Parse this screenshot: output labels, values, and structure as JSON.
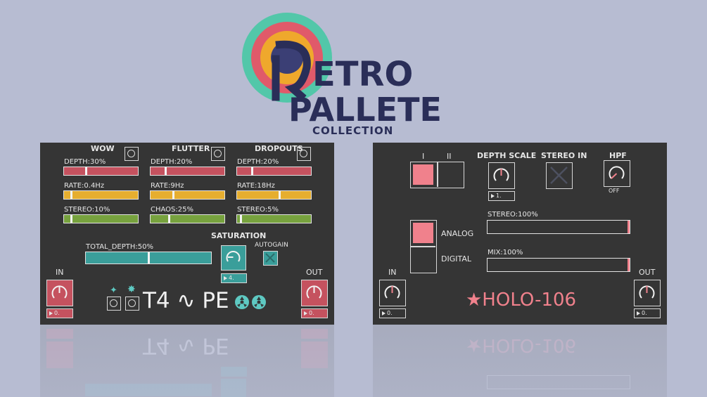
{
  "logo": {
    "retro": "ETRO",
    "pallete": "PALLETE",
    "collection": "COLLECTION",
    "colors": [
      "#52c7a9",
      "#e05a6a",
      "#efa82c",
      "#3b3f75"
    ]
  },
  "tape": {
    "sections": {
      "wow": "WOW",
      "flutter": "FLUTTER",
      "dropouts": "DROPOUTS"
    },
    "wow": {
      "depth": "DEPTH:30%",
      "rate": "RATE:0.4Hz",
      "stereo": "STEREO:10%"
    },
    "flutter": {
      "depth": "DEPTH:20%",
      "rate": "RATE:9Hz",
      "chaos": "CHAOS:25%"
    },
    "dropouts": {
      "depth": "DEPTH:20%",
      "rate": "RATE:18Hz",
      "stereo": "STEREO:5%"
    },
    "levels": {
      "wow_depth": 0.3,
      "wow_rate": 0.1,
      "wow_stereo": 0.1,
      "flutter_depth": 0.2,
      "flutter_rate": 0.31,
      "flutter_chaos": 0.25,
      "dropouts_depth": 0.2,
      "dropouts_rate": 0.58,
      "dropouts_stereo": 0.05,
      "total_depth": 0.5
    },
    "saturation": "SATURATION",
    "autogain": "AUTOGAIN",
    "total_depth": "TOTAL_DEPTH:50%",
    "saturation_value": "4.",
    "in_label": "IN",
    "out_label": "OUT",
    "in_value": "0.",
    "out_value": "0.",
    "name": "T4 ∿ PE",
    "colors": {
      "red": "#c5525f",
      "yellow": "#e6ae2f",
      "green": "#77a23e",
      "teal": "#3a9e9a"
    }
  },
  "holo": {
    "mode_i": "I",
    "mode_ii": "II",
    "depth_scale": "DEPTH SCALE",
    "depth_scale_value": "1.",
    "stereo_in": "STEREO IN",
    "hpf": "HPF",
    "hpf_value": "OFF",
    "analog": "ANALOG",
    "digital": "DIGITAL",
    "stereo": "STEREO:100%",
    "mix": "MIX:100%",
    "levels": {
      "stereo": 1.0,
      "mix": 1.0
    },
    "in_label": "IN",
    "out_label": "OUT",
    "in_value": "0.",
    "out_value": "0.",
    "name": "★HOLO-106",
    "colors": {
      "pink": "#f0818c"
    }
  }
}
